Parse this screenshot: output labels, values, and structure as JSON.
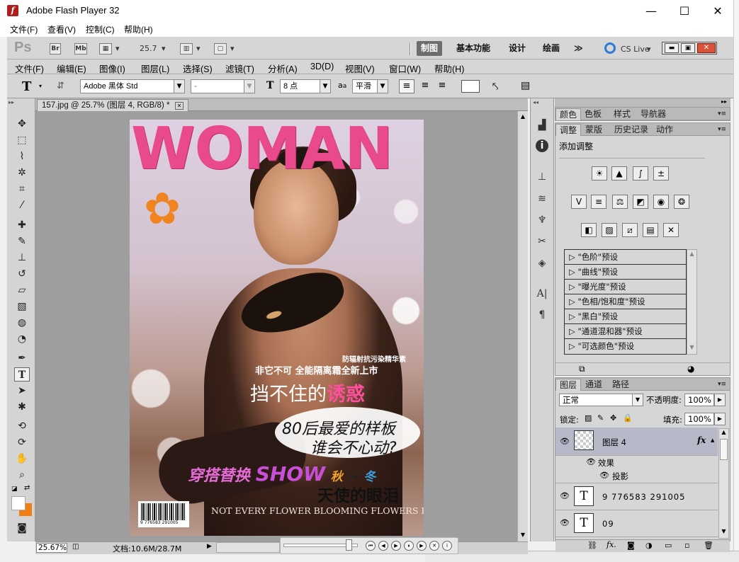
{
  "flash_window": {
    "title": "Adobe Flash Player 32",
    "minimize": "—",
    "maximize": "☐",
    "close": "✕",
    "menu": [
      "文件(F)",
      "查看(V)",
      "控制(C)",
      "帮助(H)"
    ]
  },
  "ps_appbar": {
    "logo": "Ps",
    "bridge": "Br",
    "minibridge": "Mb",
    "zoom": "25.7",
    "workspaces": [
      "制图",
      "基本功能",
      "设计",
      "绘画"
    ],
    "more": "≫",
    "cslive": "CS Live"
  },
  "ps_menu": [
    "文件(F)",
    "编辑(E)",
    "图像(I)",
    "图层(L)",
    "选择(S)",
    "滤镜(T)",
    "分析(A)",
    "3D(D)",
    "视图(V)",
    "窗口(W)",
    "帮助(H)"
  ],
  "options_bar": {
    "font_family": "Adobe 黑体 Std",
    "font_style": "-",
    "font_size": "8 点",
    "aa_label": "a",
    "anti_alias": "平滑"
  },
  "document": {
    "tab_title": "157.jpg @ 25.7% (图层 4, RGB/8) *",
    "zoom_status": "25.67%",
    "doc_size": "文档:10.6M/28.7M"
  },
  "cover": {
    "title": "WOMAN",
    "antirad": "防辐射抗污染精华素",
    "tagline": "非它不可 全能隔离霜全新上市",
    "headline_a": "挡不住的",
    "headline_b": "诱惑",
    "bubble_line1": "80后最爱的样板",
    "bubble_line2": "谁会不心动?",
    "mix_a": "穿搭替换",
    "mix_show": "SHOW",
    "season_a": "秋",
    "season_arrow": "→",
    "season_b": "冬",
    "angel": "天使的眼泪",
    "english": "NOT EVERY FLOWER BLOOMING FLOWERS FOR LOVE",
    "barcode_num": "9 776583 291005"
  },
  "panels": {
    "top_tabs": [
      "颜色",
      "色板",
      "样式",
      "导航器"
    ],
    "adj_tabs": [
      "调整",
      "蒙版",
      "历史记录",
      "动作"
    ],
    "add_adjustment": "添加调整",
    "presets": [
      "\"色阶\"预设",
      "\"曲线\"预设",
      "\"曝光度\"预设",
      "\"色相/饱和度\"预设",
      "\"黑白\"预设",
      "\"通道混和器\"预设",
      "\"可选颜色\"预设"
    ],
    "layer_tabs": [
      "图层",
      "通道",
      "路径"
    ],
    "blend_mode": "正常",
    "opacity_label": "不透明度:",
    "opacity": "100%",
    "lock_label": "锁定:",
    "fill_label": "填充:",
    "fill": "100%",
    "layers": [
      {
        "name": "图层 4",
        "fx": "fx"
      },
      {
        "name": "效果"
      },
      {
        "name": "投影"
      },
      {
        "name": "9 776583 291005"
      },
      {
        "name": "09"
      }
    ]
  }
}
